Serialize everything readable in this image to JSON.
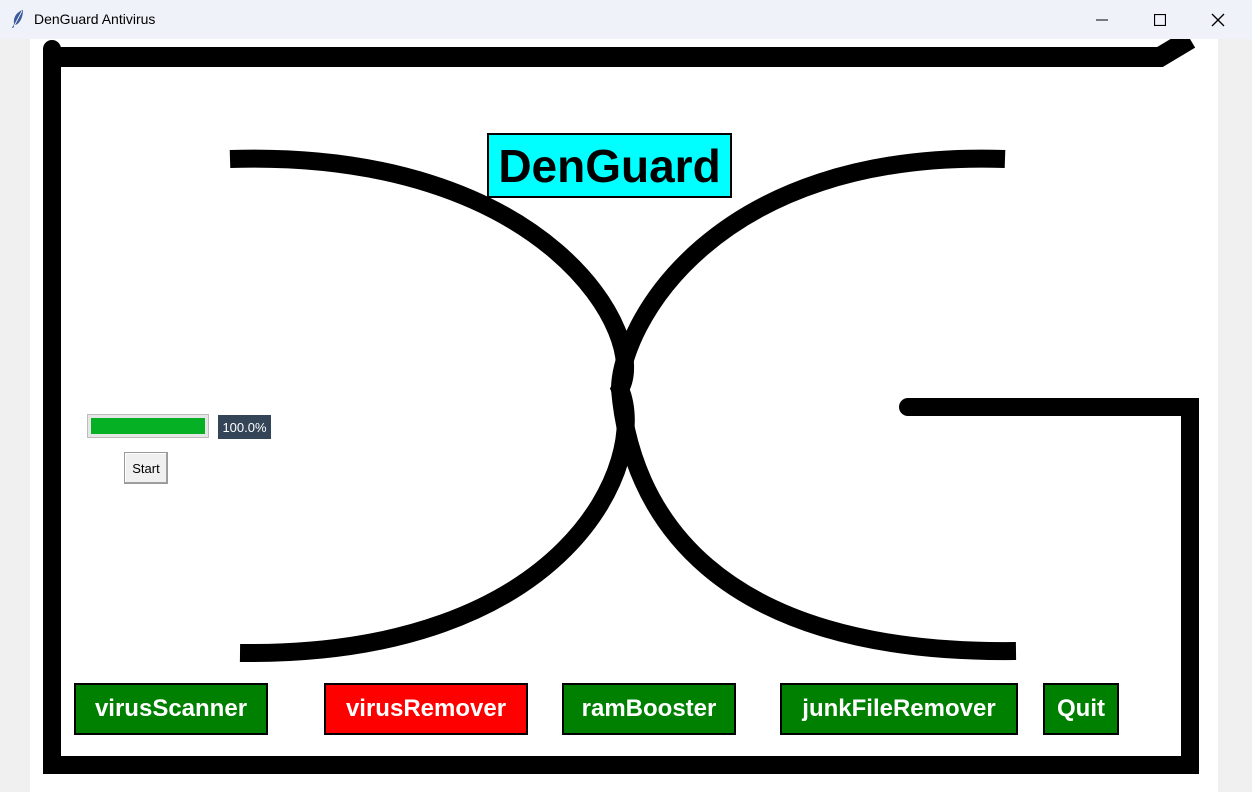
{
  "window": {
    "title": "DenGuard Antivirus",
    "app_icon": "feather-icon",
    "controls": [
      "minimize-icon",
      "maximize-icon",
      "close-icon"
    ]
  },
  "app": {
    "title": "DenGuard",
    "title_bg": "#00ffff"
  },
  "progress": {
    "value_percent": 100.0,
    "label": "100.0%",
    "fill_color": "#06b025"
  },
  "start_button": {
    "label": "Start"
  },
  "actions": {
    "virus_scanner": {
      "label": "virusScanner",
      "color": "#008000"
    },
    "virus_remover": {
      "label": "virusRemover",
      "color": "#ff0000"
    },
    "ram_booster": {
      "label": "ramBooster",
      "color": "#008000"
    },
    "junk_file_remover": {
      "label": "junkFileRemover",
      "color": "#008000"
    },
    "quit": {
      "label": "Quit",
      "color": "#008000"
    }
  }
}
